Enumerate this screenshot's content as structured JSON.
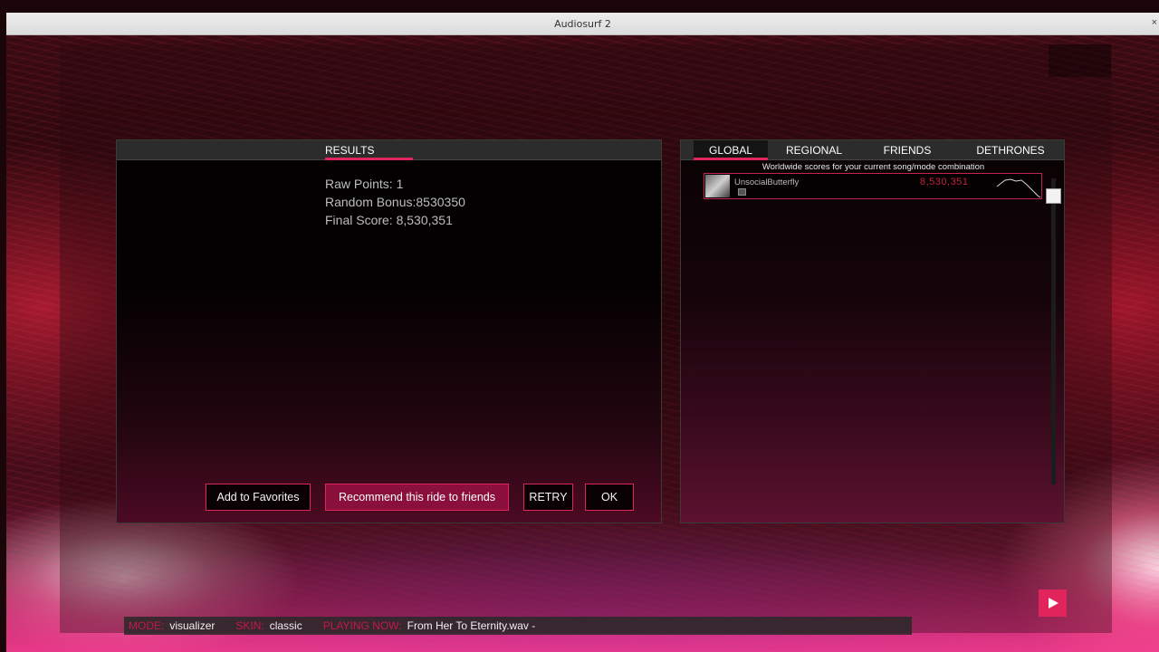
{
  "window": {
    "title": "Audiosurf 2",
    "close_glyph": "×"
  },
  "results": {
    "tab": "RESULTS",
    "raw_points": "Raw Points: 1",
    "random_bonus": "Random Bonus:8530350",
    "final_score": "Final Score: 8,530,351",
    "buttons": {
      "favorites": "Add to Favorites",
      "recommend": "Recommend this ride to friends",
      "retry": "RETRY",
      "ok": "OK"
    }
  },
  "leaderboard": {
    "tabs": [
      {
        "label": "GLOBAL",
        "active": true
      },
      {
        "label": "REGIONAL",
        "active": false
      },
      {
        "label": "FRIENDS",
        "active": false
      },
      {
        "label": "DETHRONES",
        "active": false
      }
    ],
    "caption": "Worldwide scores for your current song/mode combination",
    "entries": [
      {
        "name": "UnsocialButterfly",
        "score": "8,530,351"
      }
    ]
  },
  "status_bar": {
    "mode_key": "MODE:",
    "mode_value": "visualizer",
    "skin_key": "SKIN:",
    "skin_value": "classic",
    "playing_key": "PLAYING NOW:",
    "playing_value": "From Her To Eternity.wav -"
  },
  "icons": {
    "play": "play-icon",
    "flag": "flag-icon",
    "avatar": "avatar-image"
  },
  "colors": {
    "accent": "#e0245e",
    "score": "#c2203f",
    "recommend_bg": "#8a0f3a"
  }
}
